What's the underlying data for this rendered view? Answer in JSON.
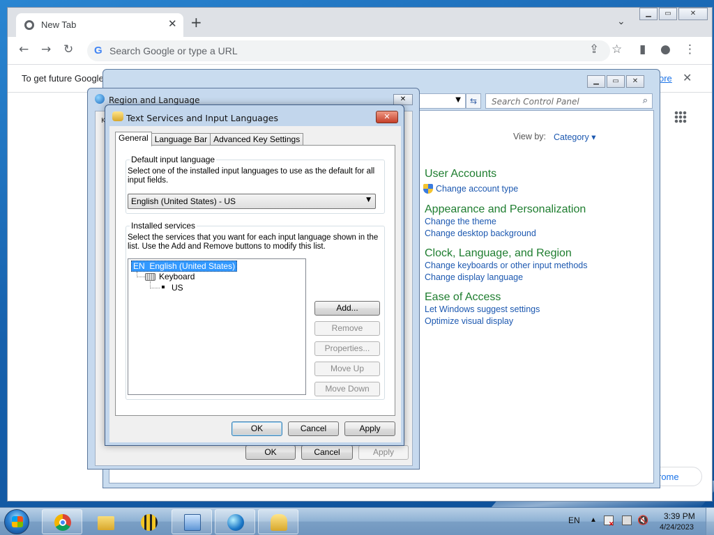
{
  "chrome": {
    "tab_title": "New Tab",
    "omnibox_placeholder": "Search Google or type a URL",
    "infobar_text": "To get future Google",
    "infobar_link": "ore",
    "customize_label": "rome"
  },
  "control_panel": {
    "search_placeholder": "Search Control Panel",
    "view_by_label": "View by:",
    "view_by_value": "Category",
    "categories": [
      {
        "title": "User Accounts",
        "links": [
          "Change account type"
        ]
      },
      {
        "title": "Appearance and Personalization",
        "links": [
          "Change the theme",
          "Change desktop background"
        ]
      },
      {
        "title": "Clock, Language, and Region",
        "links": [
          "Change keyboards or other input methods",
          "Change display language"
        ]
      },
      {
        "title": "Ease of Access",
        "links": [
          "Let Windows suggest settings",
          "Optimize visual display"
        ]
      }
    ]
  },
  "region_dialog": {
    "title": "Region and Language",
    "partial_label": "K",
    "ok": "OK",
    "cancel": "Cancel",
    "apply": "Apply"
  },
  "text_services": {
    "title": "Text Services and Input Languages",
    "tabs": [
      "General",
      "Language Bar",
      "Advanced Key Settings"
    ],
    "default_group": {
      "label": "Default input language",
      "description": "Select one of the installed input languages to use as the default for all input fields.",
      "selected": "English (United States) - US"
    },
    "installed_group": {
      "label": "Installed services",
      "description": "Select the services that you want for each input language shown in the list. Use the Add and Remove buttons to modify this list.",
      "tree": {
        "lang_code": "EN",
        "language": "English (United States)",
        "category": "Keyboard",
        "layout": "US"
      },
      "buttons": [
        "Add...",
        "Remove",
        "Properties...",
        "Move Up",
        "Move Down"
      ]
    },
    "ok": "OK",
    "cancel": "Cancel",
    "apply": "Apply"
  },
  "taskbar": {
    "lang": "EN",
    "time": "3:39 PM",
    "date": "4/24/2023"
  }
}
